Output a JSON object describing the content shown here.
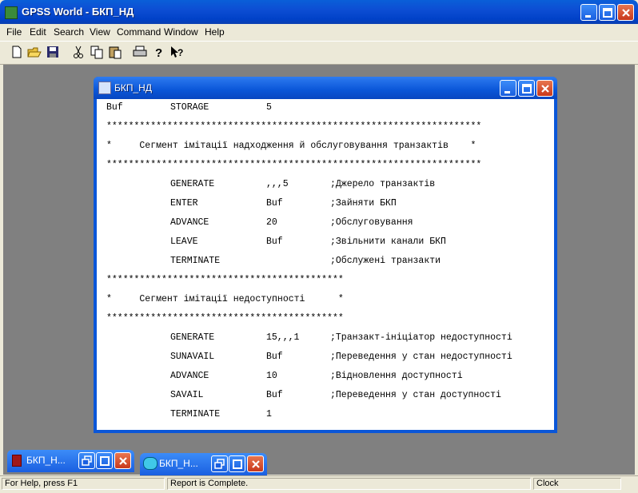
{
  "app": {
    "title": "GPSS World - БКП_НД"
  },
  "menu": [
    "File",
    "Edit",
    "Search",
    "View",
    "Command",
    "Window",
    "Help"
  ],
  "toolbar_icons": [
    "new-icon",
    "open-icon",
    "save-icon",
    "cut-icon",
    "copy-icon",
    "paste-icon",
    "print-icon",
    "help-icon",
    "context-help-icon"
  ],
  "child_window": {
    "title": "БКП_НД",
    "lines": [
      {
        "label": "Buf",
        "op": "STORAGE",
        "arg": "5",
        "comment": ""
      },
      {
        "raw": "********************************************************************"
      },
      {
        "raw": "*     Сегмент імітації надходження й обслуговування транзактів    *"
      },
      {
        "raw": "********************************************************************"
      },
      {
        "label": "",
        "op": "GENERATE",
        "arg": ",,,5",
        "comment": ";Джерело транзактів"
      },
      {
        "label": "",
        "op": "ENTER",
        "arg": "Buf",
        "comment": ";Зайняти БКП"
      },
      {
        "label": "",
        "op": "ADVANCE",
        "arg": "20",
        "comment": ";Обслуговування"
      },
      {
        "label": "",
        "op": "LEAVE",
        "arg": "Buf",
        "comment": ";Звільнити канали БКП"
      },
      {
        "label": "",
        "op": "TERMINATE",
        "arg": "",
        "comment": ";Обслужені транзакти"
      },
      {
        "raw": "*******************************************"
      },
      {
        "raw": "*     Сегмент імітації недоступності      *"
      },
      {
        "raw": "*******************************************"
      },
      {
        "label": "",
        "op": "GENERATE",
        "arg": "15,,,1",
        "comment": ";Транзакт-ініціатор недоступності"
      },
      {
        "label": "",
        "op": "SUNAVAIL",
        "arg": "Buf",
        "comment": ";Переведення у стан недоступності"
      },
      {
        "label": "",
        "op": "ADVANCE",
        "arg": "10",
        "comment": ";Відновлення доступності"
      },
      {
        "label": "",
        "op": "SAVAIL",
        "arg": "Buf",
        "comment": ";Переведення у стан доступності"
      },
      {
        "label": "",
        "op": "TERMINATE",
        "arg": "1",
        "comment": ""
      }
    ]
  },
  "minimized": [
    {
      "title": "БКП_Н..."
    },
    {
      "title": "БКП_Н..."
    }
  ],
  "status": {
    "help": "For Help, press F1",
    "message": "Report is Complete.",
    "clock": "Clock"
  }
}
